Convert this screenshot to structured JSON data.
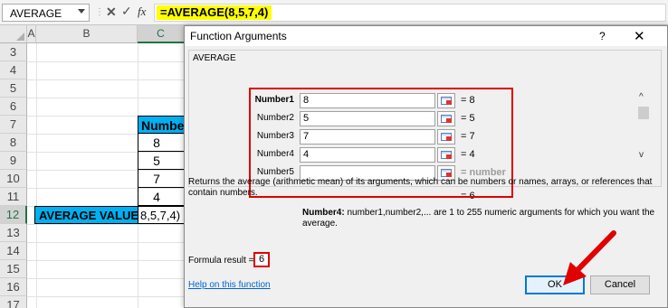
{
  "formula_bar": {
    "name_box": "AVERAGE",
    "cancel_glyph": "✕",
    "enter_glyph": "✓",
    "fx_label": "fx",
    "formula": "=AVERAGE(8,5,7,4)"
  },
  "columns": [
    "A",
    "B",
    "C"
  ],
  "rows": [
    "3",
    "4",
    "5",
    "6",
    "7",
    "8",
    "9",
    "10",
    "11",
    "12",
    "13",
    "14",
    "15",
    "16",
    "17"
  ],
  "sheet": {
    "header_cell": "Numbers",
    "numbers": [
      "8",
      "5",
      "7",
      "4"
    ],
    "avg_label": "AVERAGE VALUE",
    "avg_value": "8,5,7,4)"
  },
  "dialog": {
    "title": "Function Arguments",
    "help": "?",
    "close": "✕",
    "function_name": "AVERAGE",
    "args": [
      {
        "label": "Number1",
        "value": "8",
        "result": "=  8"
      },
      {
        "label": "Number2",
        "value": "5",
        "result": "=  5"
      },
      {
        "label": "Number3",
        "value": "7",
        "result": "=  7"
      },
      {
        "label": "Number4",
        "value": "4",
        "result": "=  4"
      },
      {
        "label": "Number5",
        "value": "",
        "result": "=  number"
      }
    ],
    "result_line": "=  6",
    "description": "Returns the average (arithmetic mean) of its arguments, which can be numbers or names, arrays, or references that contain numbers.",
    "arg_desc_name": "Number4:",
    "arg_desc_text": "number1,number2,... are 1 to 255 numeric arguments for which you want the average.",
    "formula_result_label": "Formula result =",
    "formula_result_value": "6",
    "help_link": "Help on this function",
    "ok": "OK",
    "cancel": "Cancel"
  },
  "colors": {
    "header_fill": "#00b0f0",
    "annotation_red": "#e00000",
    "formula_highlight": "#ffff00"
  }
}
